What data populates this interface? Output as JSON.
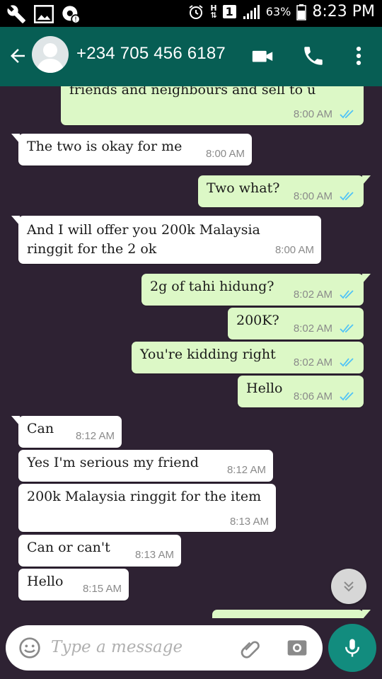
{
  "status_bar": {
    "battery": "63%",
    "time": "8:23 PM",
    "signal_badge": "1",
    "network_h": "H"
  },
  "header": {
    "contact": "+234 705 456 6187"
  },
  "messages": [
    {
      "dir": "out",
      "text": "friends and neighbours and sell to u",
      "time": "8:00 AM"
    },
    {
      "dir": "in",
      "text": "The two is okay for me",
      "time": "8:00 AM"
    },
    {
      "dir": "out",
      "text": "Two what?",
      "time": "8:00 AM"
    },
    {
      "dir": "in",
      "text": "And I will offer you 200k Malaysia ringgit for the 2 ok",
      "time": "8:00 AM"
    },
    {
      "dir": "out",
      "text": "2g of tahi hidung?",
      "time": "8:02 AM"
    },
    {
      "dir": "out",
      "text": "200K?",
      "time": "8:02 AM"
    },
    {
      "dir": "out",
      "text": "You're kidding right",
      "time": "8:02 AM"
    },
    {
      "dir": "out",
      "text": "Hello",
      "time": "8:06 AM"
    },
    {
      "dir": "in",
      "text": "Can",
      "time": "8:12 AM"
    },
    {
      "dir": "in",
      "text": "Yes I'm serious my friend",
      "time": "8:12 AM"
    },
    {
      "dir": "in",
      "text": "200k Malaysia ringgit for the item",
      "time": "8:13 AM"
    },
    {
      "dir": "in",
      "text": "Can or can't",
      "time": "8:13 AM"
    },
    {
      "dir": "in",
      "text": "Hello",
      "time": "8:15 AM"
    }
  ],
  "composer": {
    "placeholder": "Type a message"
  },
  "colors": {
    "appbar": "#075e54",
    "outgoing": "#dcf8c6",
    "incoming": "#ffffff",
    "read_tick": "#4fc3f7",
    "mic": "#128c7e"
  },
  "icons": [
    "wrench-icon",
    "image-icon",
    "settings-icon",
    "alarm-icon",
    "signal-icon",
    "battery-icon",
    "back-arrow-icon",
    "avatar-icon",
    "video-call-icon",
    "phone-icon",
    "more-icon",
    "scroll-down-icon",
    "emoji-icon",
    "attach-icon",
    "camera-icon",
    "mic-icon"
  ]
}
